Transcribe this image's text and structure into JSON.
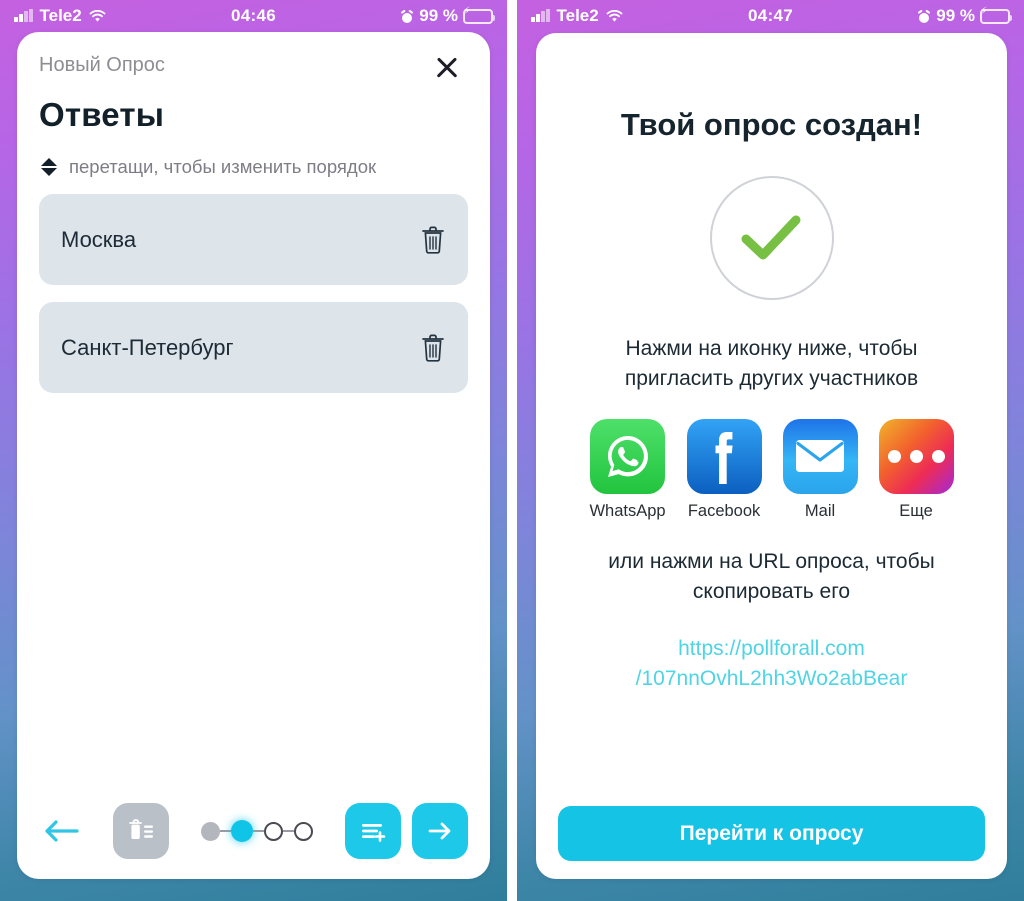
{
  "left": {
    "statusbar": {
      "carrier": "Tele2",
      "time": "04:46",
      "battery_percent": "99 %",
      "signal_icon": "signal-bars-icon",
      "wifi_icon": "wifi-icon",
      "alarm_icon": "alarm-clock-icon",
      "battery_icon": "battery-charging-icon"
    },
    "header": {
      "subtitle": "Новый Опрос",
      "close_icon": "close-icon"
    },
    "title": "Ответы",
    "hint": {
      "icon": "drag-reorder-icon",
      "text": "перетащи, чтобы изменить порядок"
    },
    "answers": [
      {
        "text": "Москва",
        "delete_icon": "trash-icon"
      },
      {
        "text": "Санкт-Петербург",
        "delete_icon": "trash-icon"
      }
    ],
    "bottombar": {
      "back_icon": "arrow-left-icon",
      "clear_list_icon": "delete-list-icon",
      "add_answer_icon": "add-list-item-icon",
      "next_icon": "arrow-right-icon",
      "steps": [
        {
          "state": "done"
        },
        {
          "state": "active"
        },
        {
          "state": "todo"
        },
        {
          "state": "todo"
        }
      ],
      "active_step": 2,
      "total_steps": 4
    }
  },
  "right": {
    "statusbar": {
      "carrier": "Tele2",
      "time": "04:47",
      "battery_percent": "99 %",
      "signal_icon": "signal-bars-icon",
      "wifi_icon": "wifi-icon",
      "alarm_icon": "alarm-clock-icon",
      "battery_icon": "battery-charging-icon"
    },
    "title": "Твой опрос создан!",
    "success_icon": "checkmark-circle-icon",
    "invite_text": "Нажми на иконку ниже, чтобы пригласить других участников",
    "share_targets": [
      {
        "label": "WhatsApp",
        "icon": "whatsapp-icon"
      },
      {
        "label": "Facebook",
        "icon": "facebook-icon"
      },
      {
        "label": "Mail",
        "icon": "mail-envelope-icon"
      },
      {
        "label": "Еще",
        "icon": "more-dots-icon"
      }
    ],
    "copy_text": "или нажми на URL опроса, чтобы скопировать его",
    "poll_url_line1": "https://pollforall.com",
    "poll_url_line2": "/107nnOvhL2hh3Wo2abBear",
    "cta_label": "Перейти к опросу"
  },
  "colors": {
    "accent_cyan": "#15c3e4",
    "url_cyan": "#4fd4e4",
    "answer_bg": "#dde4ea",
    "check_green": "#77c043",
    "gradient_top": "#c461e0",
    "gradient_bottom": "#2f7e9b"
  }
}
